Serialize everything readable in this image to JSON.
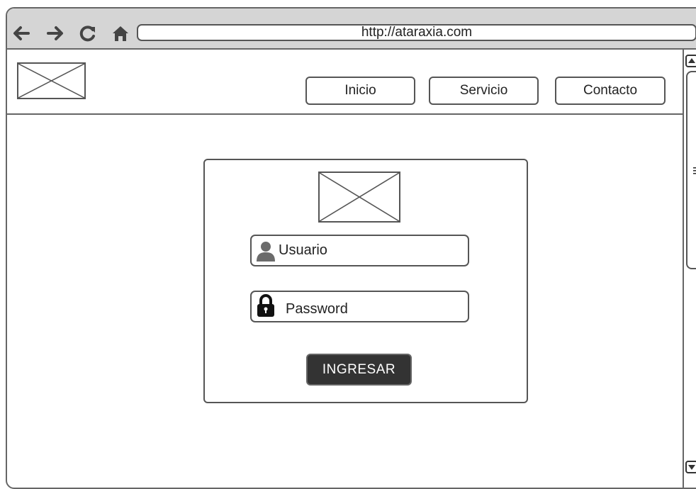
{
  "browser": {
    "url": "http://ataraxia.com",
    "nav_icons": [
      "back-arrow-icon",
      "forward-arrow-icon",
      "reload-icon",
      "home-icon"
    ]
  },
  "header": {
    "logo_icon": "image-placeholder-icon",
    "nav": [
      {
        "label": "Inicio"
      },
      {
        "label": "Servicio"
      },
      {
        "label": "Contacto"
      }
    ]
  },
  "login": {
    "image_icon": "image-placeholder-icon",
    "username": {
      "icon": "user-icon",
      "placeholder": "Usuario"
    },
    "password": {
      "icon": "lock-icon",
      "placeholder": "Password"
    },
    "submit_label": "INGRESAR"
  },
  "colors": {
    "frame_border": "#666666",
    "titlebar_bg": "#d5d5d5",
    "button_dark": "#333333"
  }
}
